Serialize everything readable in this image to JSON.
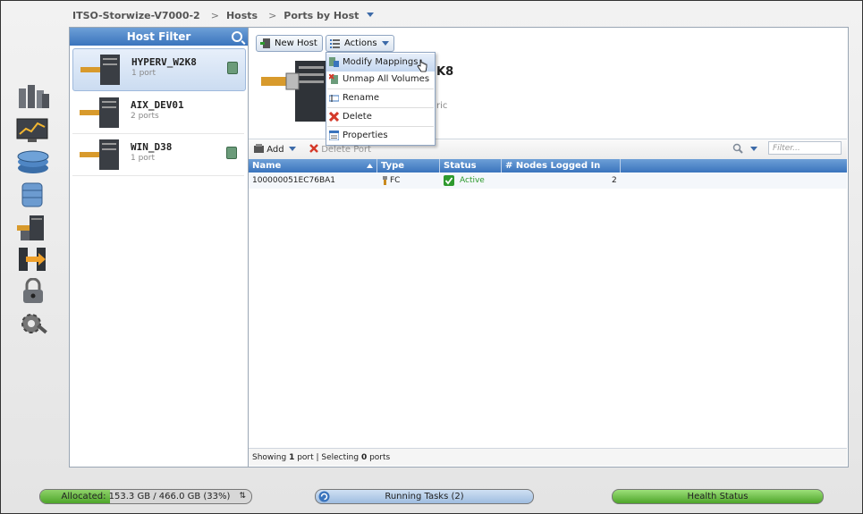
{
  "breadcrumb": {
    "system": "ITSO-Storwize-V7000-2",
    "section": "Hosts",
    "page": "Ports by Host",
    "separator": ">"
  },
  "host_filter": {
    "title": "Host Filter",
    "hosts": [
      {
        "name": "HYPERV_W2K8",
        "ports": "1 port",
        "selected": true
      },
      {
        "name": "AIX_DEV01",
        "ports": "2 ports",
        "selected": false
      },
      {
        "name": "WIN_D38",
        "ports": "1 port",
        "selected": false
      }
    ]
  },
  "toolbar": {
    "new_host": "New Host",
    "actions": "Actions"
  },
  "host_detail": {
    "title_fragment": "K8",
    "subtitle_fragment": "ric"
  },
  "actions_menu": {
    "items": [
      {
        "label": "Modify Mappings",
        "icon": "modify-mappings-icon",
        "highlighted": true
      },
      {
        "label": "Unmap All Volumes",
        "icon": "unmap-volumes-icon",
        "highlighted": false
      },
      {
        "label": "Rename",
        "icon": "rename-icon",
        "highlighted": false
      },
      {
        "label": "Delete",
        "icon": "delete-icon",
        "highlighted": false
      },
      {
        "label": "Properties",
        "icon": "properties-icon",
        "highlighted": false
      }
    ]
  },
  "ports_toolbar": {
    "add": "Add",
    "delete_port": "Delete Port",
    "filter_placeholder": "Filter..."
  },
  "table": {
    "columns": [
      "Name",
      "Type",
      "Status",
      "# Nodes Logged In"
    ],
    "rows": [
      {
        "name": "100000051EC76BA1",
        "type": "FC",
        "status": "Active",
        "nodes_logged_in": "2"
      }
    ]
  },
  "footer": {
    "showing_prefix": "Showing ",
    "showing_count": "1",
    "showing_mid": " port | Selecting ",
    "selecting_count": "0",
    "showing_suffix": " ports"
  },
  "status_bars": {
    "allocated": "Allocated: 153.3 GB / 466.0 GB (33%)",
    "allocated_fraction": 0.33,
    "running_tasks": "Running Tasks (2)",
    "health": "Health Status"
  },
  "colors": {
    "header_blue": "#3a74bd",
    "active_green": "#2e9a2e",
    "health_green": "#5fbf3a",
    "delete_red": "#d43a2a"
  }
}
